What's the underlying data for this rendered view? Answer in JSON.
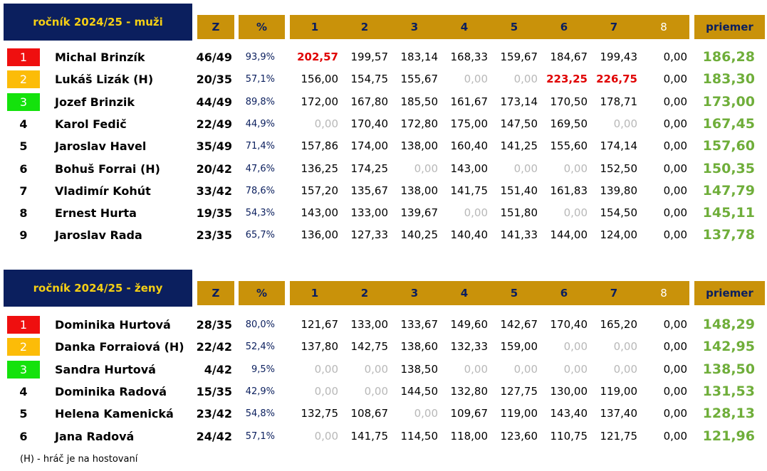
{
  "headers": {
    "z": "Z",
    "pct": "%",
    "rounds": [
      "1",
      "2",
      "3",
      "4",
      "5",
      "6",
      "7",
      "8"
    ],
    "avg": "priemer"
  },
  "sections": [
    {
      "title": "ročník 2024/25 - muži",
      "rows": [
        {
          "rank": "1",
          "name": "Michal Brinzík",
          "z": "46/49",
          "pct": "93,9%",
          "vals": [
            "202,57",
            "199,57",
            "183,14",
            "168,33",
            "159,67",
            "184,67",
            "199,43",
            "0,00"
          ],
          "avg": "186,28",
          "hl": [
            0
          ]
        },
        {
          "rank": "2",
          "name": "Lukáš Lizák (H)",
          "z": "20/35",
          "pct": "57,1%",
          "vals": [
            "156,00",
            "154,75",
            "155,67",
            "0,00",
            "0,00",
            "223,25",
            "226,75",
            "0,00"
          ],
          "avg": "183,30",
          "hl": [
            5,
            6
          ]
        },
        {
          "rank": "3",
          "name": "Jozef Brinzik",
          "z": "44/49",
          "pct": "89,8%",
          "vals": [
            "172,00",
            "167,80",
            "185,50",
            "161,67",
            "173,14",
            "170,50",
            "178,71",
            "0,00"
          ],
          "avg": "173,00",
          "hl": []
        },
        {
          "rank": "4",
          "name": "Karol Fedič",
          "z": "22/49",
          "pct": "44,9%",
          "vals": [
            "0,00",
            "170,40",
            "172,80",
            "175,00",
            "147,50",
            "169,50",
            "0,00",
            "0,00"
          ],
          "avg": "167,45",
          "hl": []
        },
        {
          "rank": "5",
          "name": "Jaroslav Havel",
          "z": "35/49",
          "pct": "71,4%",
          "vals": [
            "157,86",
            "174,00",
            "138,00",
            "160,40",
            "141,25",
            "155,60",
            "174,14",
            "0,00"
          ],
          "avg": "157,60",
          "hl": []
        },
        {
          "rank": "6",
          "name": "Bohuš Forrai (H)",
          "z": "20/42",
          "pct": "47,6%",
          "vals": [
            "136,25",
            "174,25",
            "0,00",
            "143,00",
            "0,00",
            "0,00",
            "152,50",
            "0,00"
          ],
          "avg": "150,35",
          "hl": []
        },
        {
          "rank": "7",
          "name": "Vladimír Kohút",
          "z": "33/42",
          "pct": "78,6%",
          "vals": [
            "157,20",
            "135,67",
            "138,00",
            "141,75",
            "151,40",
            "161,83",
            "139,80",
            "0,00"
          ],
          "avg": "147,79",
          "hl": []
        },
        {
          "rank": "8",
          "name": "Ernest Hurta",
          "z": "19/35",
          "pct": "54,3%",
          "vals": [
            "143,00",
            "133,00",
            "139,67",
            "0,00",
            "151,80",
            "0,00",
            "154,50",
            "0,00"
          ],
          "avg": "145,11",
          "hl": []
        },
        {
          "rank": "9",
          "name": "Jaroslav Rada",
          "z": "23/35",
          "pct": "65,7%",
          "vals": [
            "136,00",
            "127,33",
            "140,25",
            "140,40",
            "141,33",
            "144,00",
            "124,00",
            "0,00"
          ],
          "avg": "137,78",
          "hl": []
        }
      ]
    },
    {
      "title": "ročník 2024/25 - ženy",
      "rows": [
        {
          "rank": "1",
          "name": "Dominika Hurtová",
          "z": "28/35",
          "pct": "80,0%",
          "vals": [
            "121,67",
            "133,00",
            "133,67",
            "149,60",
            "142,67",
            "170,40",
            "165,20",
            "0,00"
          ],
          "avg": "148,29",
          "hl": []
        },
        {
          "rank": "2",
          "name": "Danka Forraiová (H)",
          "z": "22/42",
          "pct": "52,4%",
          "vals": [
            "137,80",
            "142,75",
            "138,60",
            "132,33",
            "159,00",
            "0,00",
            "0,00",
            "0,00"
          ],
          "avg": "142,95",
          "hl": []
        },
        {
          "rank": "3",
          "name": "Sandra Hurtová",
          "z": "4/42",
          "pct": "9,5%",
          "vals": [
            "0,00",
            "0,00",
            "138,50",
            "0,00",
            "0,00",
            "0,00",
            "0,00",
            "0,00"
          ],
          "avg": "138,50",
          "hl": []
        },
        {
          "rank": "4",
          "name": "Dominika Radová",
          "z": "15/35",
          "pct": "42,9%",
          "vals": [
            "0,00",
            "0,00",
            "144,50",
            "132,80",
            "127,75",
            "130,00",
            "119,00",
            "0,00"
          ],
          "avg": "131,53",
          "hl": []
        },
        {
          "rank": "5",
          "name": "Helena Kamenická",
          "z": "23/42",
          "pct": "54,8%",
          "vals": [
            "132,75",
            "108,67",
            "0,00",
            "109,67",
            "119,00",
            "143,40",
            "137,40",
            "0,00"
          ],
          "avg": "128,13",
          "hl": []
        },
        {
          "rank": "6",
          "name": "Jana Radová",
          "z": "24/42",
          "pct": "57,1%",
          "vals": [
            "0,00",
            "141,75",
            "114,50",
            "118,00",
            "123,60",
            "110,75",
            "121,75",
            "0,00"
          ],
          "avg": "121,96",
          "hl": []
        }
      ]
    }
  ],
  "footnote": "(H) - hráč je na hostovaní",
  "colors": {
    "title_bg": "#0b1f5e",
    "title_text": "#f5cf14",
    "header_bg": "#c9920a",
    "rank1": "#ef0f0f",
    "rank2": "#fcbc08",
    "rank3": "#14e20c",
    "highlight": "#e00000",
    "average": "#6fae3a",
    "zero": "#b8b8b8"
  }
}
